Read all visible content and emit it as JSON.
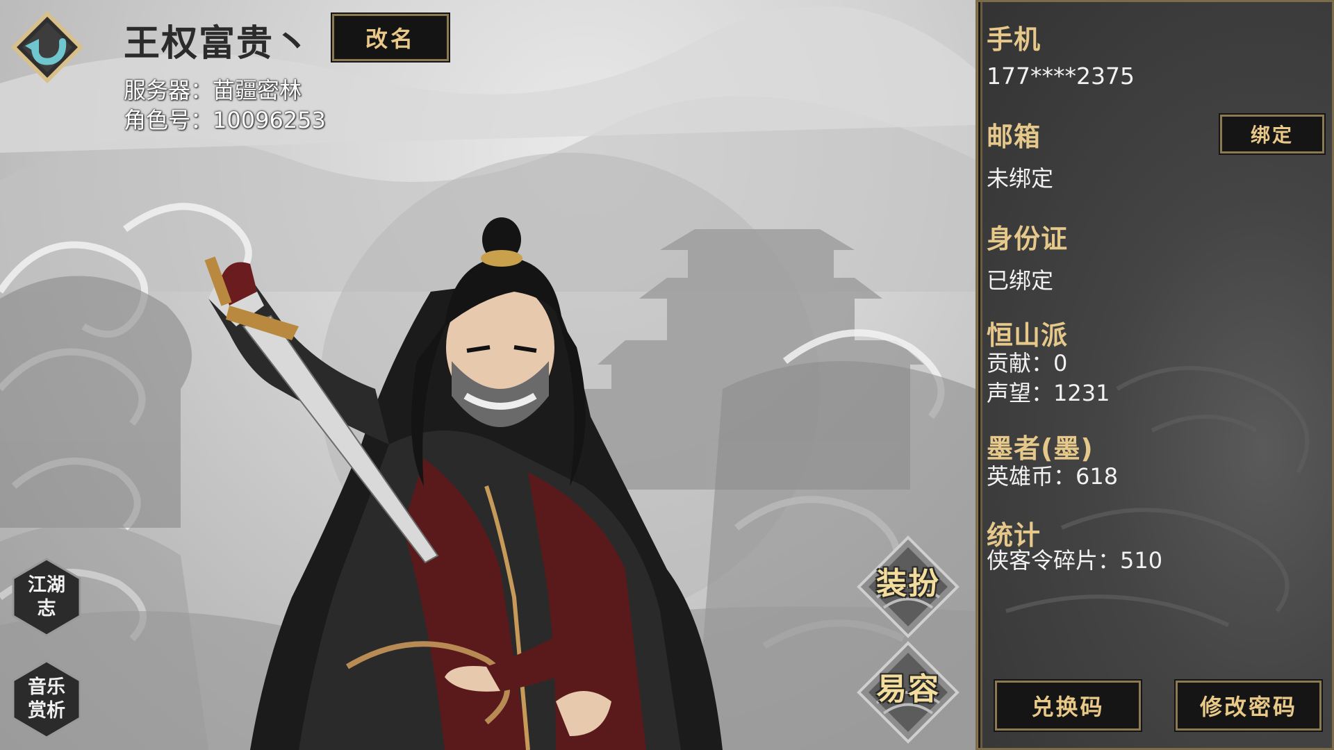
{
  "header": {
    "player_name": "王权富贵丶",
    "rename_label": "改名",
    "server_line": "服务器：苗疆密林",
    "role_id_line": "角色号：10096253"
  },
  "left_menu": {
    "jianghu": [
      "江湖",
      "志"
    ],
    "music": [
      "音乐",
      "赏析"
    ]
  },
  "action_buttons": {
    "dress": "装扮",
    "disguise": "易容"
  },
  "account_panel": {
    "phone_title": "手机",
    "phone_value": "177****2375",
    "email_title": "邮箱",
    "email_value": "未绑定",
    "bind_label": "绑定",
    "id_title": "身份证",
    "id_value": "已绑定",
    "sect_title": "恒山派",
    "sect_contribution": "贡献：0",
    "sect_fame": "声望：1231",
    "rank_title": "墨者(墨)",
    "hero_coins": "英雄币：618",
    "stats_title": "统计",
    "token_shards": "侠客令碎片：510",
    "redeem_label": "兑换码",
    "password_label": "修改密码"
  },
  "colors": {
    "accent_gold": "#e6c98a",
    "button_bg": "#151515",
    "panel_bg": "#444444",
    "back_arrow": "#6fc6cf"
  },
  "icons": {
    "back": "back-arrow-icon",
    "character": "swordsman-character-art"
  }
}
